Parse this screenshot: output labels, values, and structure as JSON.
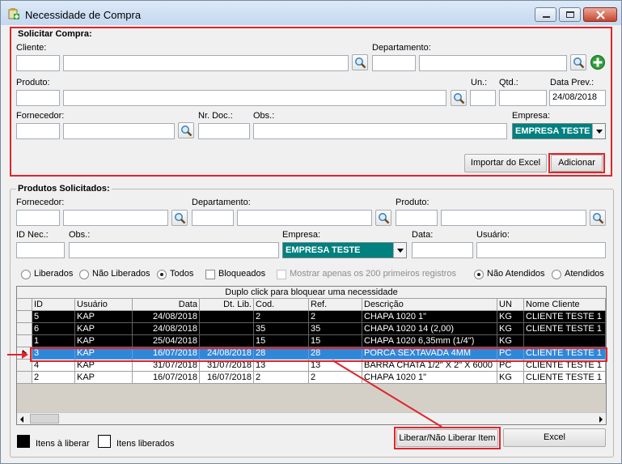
{
  "window": {
    "title": "Necessidade de Compra"
  },
  "solicitar": {
    "header": "Solicitar Compra:",
    "cliente_label": "Cliente:",
    "departamento_label": "Departamento:",
    "produto_label": "Produto:",
    "un_label": "Un.:",
    "qtd_label": "Qtd.:",
    "data_prev_label": "Data Prev.:",
    "data_prev_value": "24/08/2018",
    "fornecedor_label": "Fornecedor:",
    "nr_doc_label": "Nr. Doc.:",
    "obs_label": "Obs.:",
    "empresa_label": "Empresa:",
    "empresa_value": "EMPRESA TESTE",
    "importar_button": "Importar do Excel",
    "adicionar_button": "Adicionar"
  },
  "produtos": {
    "header": "Produtos Solicitados:",
    "fornecedor_label": "Fornecedor:",
    "departamento_label": "Departamento:",
    "produto_label": "Produto:",
    "id_nec_label": "ID Nec.:",
    "obs_label": "Obs.:",
    "empresa_label": "Empresa:",
    "empresa_value": "EMPRESA TESTE",
    "data_label": "Data:",
    "usuario_label": "Usuário:"
  },
  "filters": {
    "liberados": "Liberados",
    "nao_liberados": "Não Liberados",
    "todos": "Todos",
    "bloqueados": "Bloqueados",
    "mostrar_200": "Mostrar apenas os 200 primeiros registros",
    "nao_atendidos": "Não Atendidos",
    "atendidos": "Atendidos",
    "selected_status": "Todos",
    "selected_atendimento": "Não Atendidos"
  },
  "grid": {
    "caption": "Duplo click para bloquear uma necessidade",
    "columns": [
      "ID",
      "Usuário",
      "Data",
      "Dt. Lib.",
      "Cod.",
      "Ref.",
      "Descrição",
      "UN",
      "Nome Cliente"
    ],
    "rows": [
      [
        "5",
        "KAP",
        "24/08/2018",
        "",
        "2",
        "2",
        "CHAPA 1020 1\"",
        "KG",
        "CLIENTE TESTE 1"
      ],
      [
        "6",
        "KAP",
        "24/08/2018",
        "",
        "35",
        "35",
        "CHAPA 1020 14 (2,00)",
        "KG",
        "CLIENTE TESTE 1"
      ],
      [
        "1",
        "KAP",
        "25/04/2018",
        "",
        "15",
        "15",
        "CHAPA 1020 6,35mm (1/4\")",
        "KG",
        ""
      ],
      [
        "3",
        "KAP",
        "16/07/2018",
        "24/08/2018",
        "28",
        "28",
        "PORCA SEXTAVADA 4MM",
        "PC",
        "CLIENTE TESTE 1"
      ],
      [
        "4",
        "KAP",
        "31/07/2018",
        "31/07/2018",
        "13",
        "13",
        "BARRA CHATA 1/2\" X 2\" X 6000",
        "PC",
        "CLIENTE TESTE 1"
      ],
      [
        "2",
        "KAP",
        "16/07/2018",
        "16/07/2018",
        "2",
        "2",
        "CHAPA 1020 1\"",
        "KG",
        "CLIENTE TESTE 1"
      ]
    ]
  },
  "legend": {
    "itens_a_liberar": "Itens à liberar",
    "itens_liberados": "Itens liberados"
  },
  "actions": {
    "liberar_button": "Liberar/Não Liberar Item",
    "excel_button": "Excel"
  },
  "colors": {
    "accent_red": "#e0252c",
    "selection_blue": "#2f87d8",
    "empresa_teal": "#00807f"
  }
}
